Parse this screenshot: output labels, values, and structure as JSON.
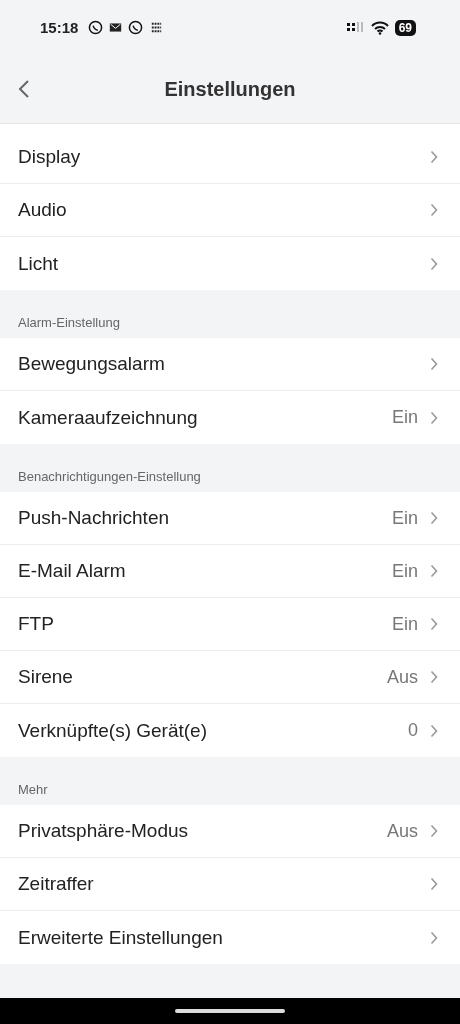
{
  "status_bar": {
    "time": "15:18",
    "battery": "69"
  },
  "header": {
    "title": "Einstellungen"
  },
  "sections": [
    {
      "items": [
        {
          "label": "Display"
        },
        {
          "label": "Audio"
        },
        {
          "label": "Licht"
        }
      ]
    },
    {
      "title": "Alarm-Einstellung",
      "items": [
        {
          "label": "Bewegungsalarm"
        },
        {
          "label": "Kameraaufzeichnung",
          "value": "Ein"
        }
      ]
    },
    {
      "title": "Benachrichtigungen-Einstellung",
      "items": [
        {
          "label": "Push-Nachrichten",
          "value": "Ein"
        },
        {
          "label": "E-Mail Alarm",
          "value": "Ein"
        },
        {
          "label": "FTP",
          "value": "Ein"
        },
        {
          "label": "Sirene",
          "value": "Aus"
        },
        {
          "label": "Verknüpfte(s) Gerät(e)",
          "value": "0"
        }
      ]
    },
    {
      "title": "Mehr",
      "items": [
        {
          "label": "Privatsphäre-Modus",
          "value": "Aus"
        },
        {
          "label": "Zeitraffer"
        },
        {
          "label": "Erweiterte Einstellungen"
        }
      ]
    }
  ]
}
